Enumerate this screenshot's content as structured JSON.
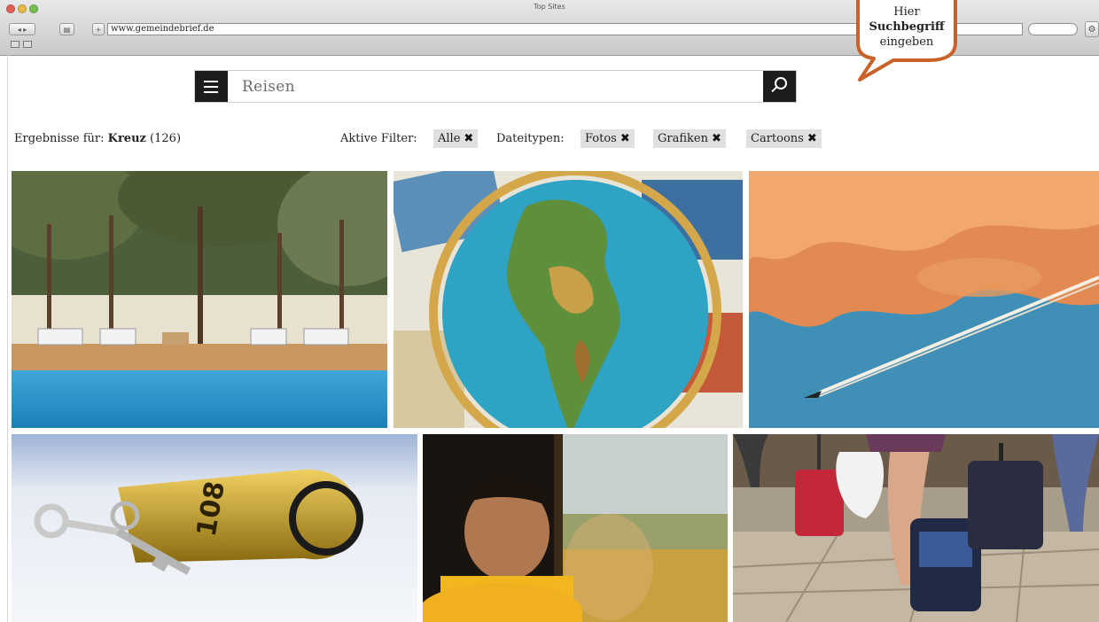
{
  "browser": {
    "window_title": "Top Sites",
    "url": "www.gemeindebrief.de",
    "back_label": "◂",
    "forward_label": "▸",
    "reader_label": "▤",
    "add_label": "+",
    "search_placeholder": "",
    "settings_label": "⚙"
  },
  "search": {
    "query": "Reisen"
  },
  "results": {
    "prefix": "Ergebnisse für: ",
    "term": "Kreuz",
    "count": " (126)"
  },
  "filters": {
    "active_label": "Aktive Filter:",
    "active_chips": [
      "Alle"
    ],
    "filetypes_label": "Dateitypen:",
    "filetype_chips": [
      "Fotos",
      "Grafiken",
      "Cartoons"
    ],
    "remove_glyph": "✖"
  },
  "tooltip": {
    "line1": "Hier",
    "line2": "Suchbegriff",
    "line3": "eingeben",
    "border_color": "#c8622a"
  },
  "tiles": [
    {
      "name": "pool-palms",
      "key_text": ""
    },
    {
      "name": "globe",
      "key_text": ""
    },
    {
      "name": "airplane-sky",
      "key_text": ""
    },
    {
      "name": "hotel-key",
      "key_text": "108"
    },
    {
      "name": "boy-window",
      "key_text": ""
    },
    {
      "name": "luggage-street",
      "key_text": ""
    }
  ],
  "colors": {
    "search_button_bg": "#1c1c1c",
    "chip_bg": "#e0e0e0",
    "bubble_border": "#c8622a"
  }
}
